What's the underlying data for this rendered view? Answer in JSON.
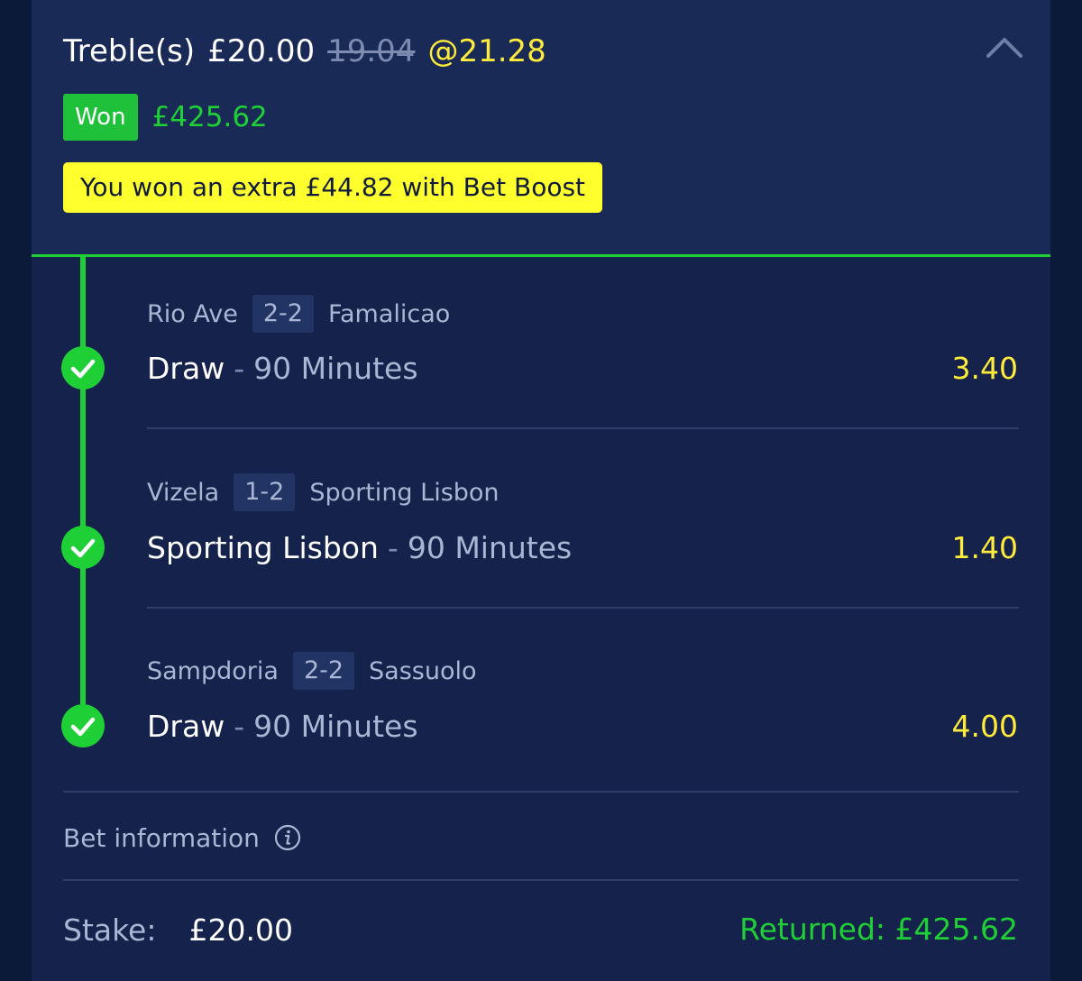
{
  "bet": {
    "type": "Treble(s)",
    "stake": "£20.00",
    "original_value": "19.04",
    "odds": "@21.28",
    "collapse_icon": "chevron-up-icon"
  },
  "status": {
    "label": "Won",
    "amount": "£425.62",
    "badge_color": "#1fc13a"
  },
  "boost": {
    "text": "You won an extra £44.82 with Bet Boost",
    "color": "#ffff2e"
  },
  "selections": [
    {
      "home": "Rio Ave",
      "score": "2-2",
      "away": "Famalicao",
      "pick": "Draw",
      "separator": "-",
      "market": "90 Minutes",
      "odds": "3.40",
      "status_icon": "check-circle-icon"
    },
    {
      "home": "Vizela",
      "score": "1-2",
      "away": "Sporting Lisbon",
      "pick": "Sporting Lisbon",
      "separator": "-",
      "market": "90 Minutes",
      "odds": "1.40",
      "status_icon": "check-circle-icon"
    },
    {
      "home": "Sampdoria",
      "score": "2-2",
      "away": "Sassuolo",
      "pick": "Draw",
      "separator": "-",
      "market": "90 Minutes",
      "odds": "4.00",
      "status_icon": "check-circle-icon"
    }
  ],
  "bet_info": {
    "label": "Bet information",
    "icon": "info-icon"
  },
  "footer": {
    "stake_label": "Stake:",
    "stake_value": "£20.00",
    "returned": "Returned: £425.62"
  },
  "colors": {
    "accent_green": "#1fcf36",
    "odds_yellow": "#ffeb3b",
    "background": "#15224b"
  }
}
